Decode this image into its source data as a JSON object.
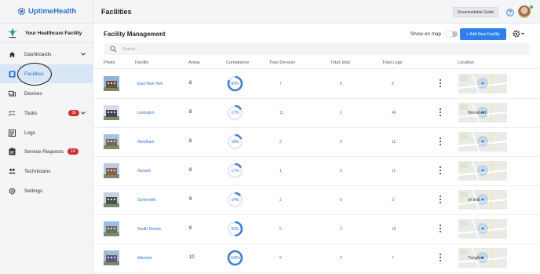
{
  "app": {
    "brand": "UptimeHealth",
    "org_name": "Your Healthcare Facility"
  },
  "colors": {
    "accent": "#2f80ed",
    "link": "#2f73c8",
    "badge": "#d32f2f",
    "active_bg": "#d9e6f6"
  },
  "sidebar": {
    "items": [
      {
        "label": "Dashboards",
        "icon": "home-icon",
        "expandable": true
      },
      {
        "label": "Facilities",
        "icon": "building-icon",
        "active": true
      },
      {
        "label": "Devices",
        "icon": "devices-icon"
      },
      {
        "label": "Tasks",
        "icon": "tasks-icon",
        "badge": "36",
        "expandable": true
      },
      {
        "label": "Logs",
        "icon": "logs-icon"
      },
      {
        "label": "Service Requests",
        "icon": "clipboard-icon",
        "badge": "14"
      },
      {
        "label": "Technicians",
        "icon": "people-icon"
      },
      {
        "label": "Settings",
        "icon": "gear-icon"
      }
    ]
  },
  "header": {
    "title": "Facilities",
    "guide_button": "Downloadable Guide"
  },
  "main": {
    "title": "Facility Management",
    "show_on_map_label": "Show on map",
    "show_on_map": false,
    "add_button": "+ Add New Facility",
    "search_placeholder": "Search...",
    "columns": [
      "Photo",
      "Facility",
      "Areas",
      "Compliance",
      "Total Devices",
      "Total Jobs",
      "Total Logs",
      "Location"
    ],
    "rows": [
      {
        "facility": "East New York",
        "areas": "8",
        "compliance": 83,
        "compliance_label": "83%",
        "devices": "7",
        "jobs": "6",
        "logs": "9",
        "map_label": ""
      },
      {
        "facility": "Lexington",
        "areas": "8",
        "compliance": 17,
        "compliance_label": "17%",
        "devices": "11",
        "jobs": "1",
        "logs": "46",
        "map_label": "Norwood"
      },
      {
        "facility": "Needham",
        "areas": "8",
        "compliance": 18,
        "compliance_label": "18%",
        "devices": "2",
        "jobs": "0",
        "logs": "11",
        "map_label": ""
      },
      {
        "facility": "Norwell",
        "areas": "8",
        "compliance": 17,
        "compliance_label": "17%",
        "devices": "1",
        "jobs": "0",
        "logs": "11",
        "map_label": ""
      },
      {
        "facility": "Somerville",
        "areas": "9",
        "compliance": 14,
        "compliance_label": "14%",
        "devices": "2",
        "jobs": "0",
        "logs": "3",
        "map_label": "of Indi"
      },
      {
        "facility": "South Dennis",
        "areas": "8",
        "compliance": 50,
        "compliance_label": "50%",
        "devices": "6",
        "jobs": "3",
        "logs": "16",
        "map_label": ""
      },
      {
        "facility": "Warwick",
        "areas": "10",
        "compliance": 100,
        "compliance_label": "100%",
        "devices": "5",
        "jobs": "2",
        "logs": "7",
        "map_label": "Twighte"
      }
    ]
  }
}
